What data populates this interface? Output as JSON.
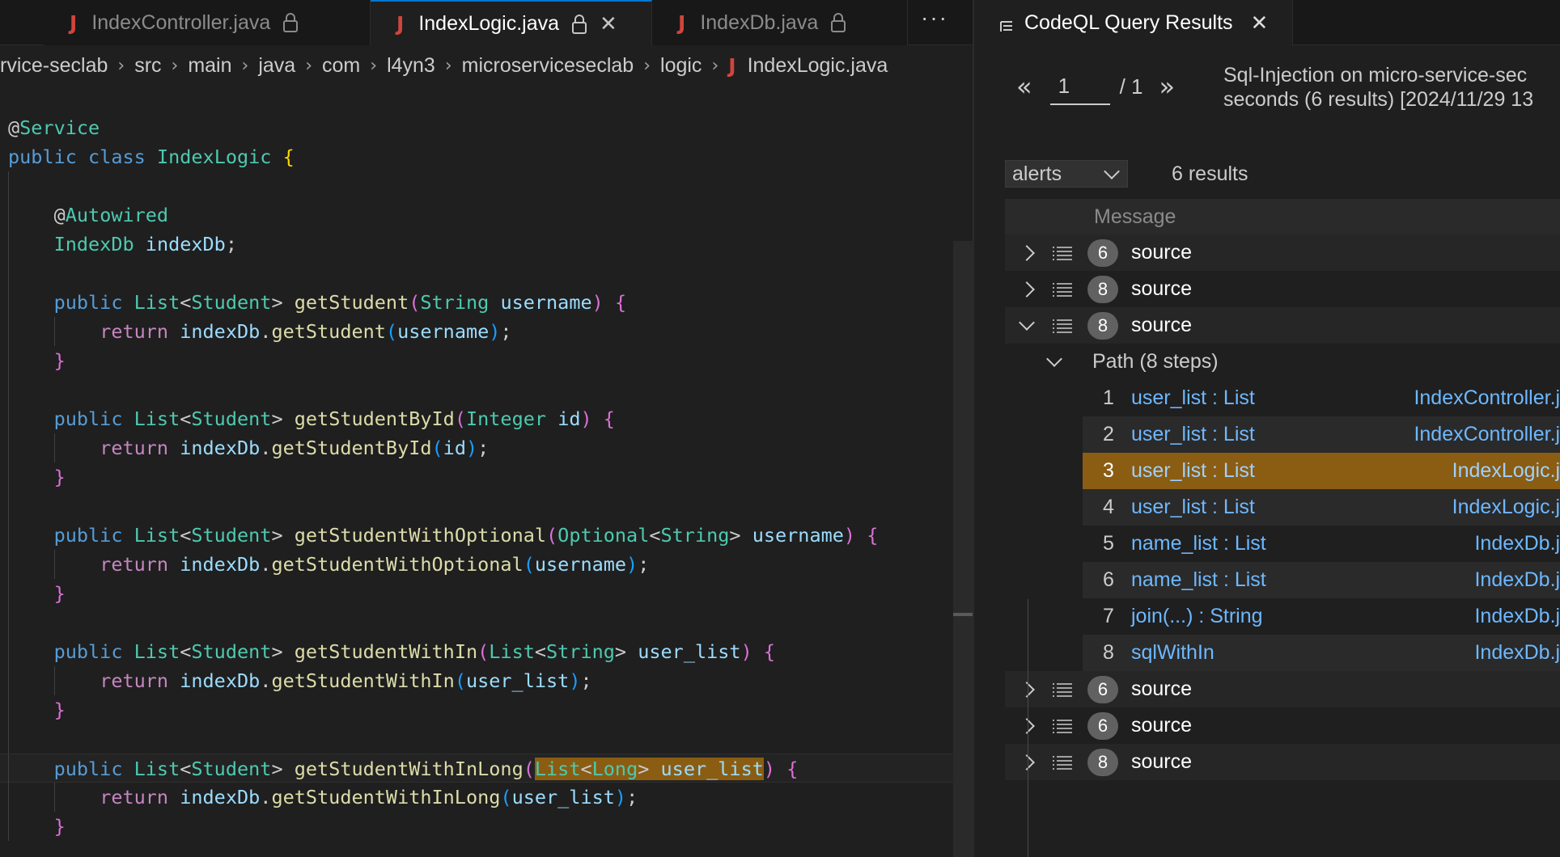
{
  "editor": {
    "tabs": [
      {
        "label": "IndexController.java",
        "locked": true,
        "active": false
      },
      {
        "label": "IndexLogic.java",
        "locked": true,
        "active": true
      },
      {
        "label": "IndexDb.java",
        "locked": true,
        "active": false
      }
    ],
    "more_label": "···",
    "file_icon_glyph": "J",
    "breadcrumb": [
      "rvice-seclab",
      "src",
      "main",
      "java",
      "com",
      "l4yn3",
      "microserviceseclab",
      "logic",
      "IndexLogic.java"
    ],
    "code_lines": [
      "@Service",
      "public class IndexLogic {",
      "",
      "    @Autowired",
      "    IndexDb indexDb;",
      "",
      "    public List<Student> getStudent(String username) {",
      "        return indexDb.getStudent(username);",
      "    }",
      "",
      "    public List<Student> getStudentById(Integer id) {",
      "        return indexDb.getStudentById(id);",
      "    }",
      "",
      "    public List<Student> getStudentWithOptional(Optional<String> username) {",
      "        return indexDb.getStudentWithOptional(username);",
      "    }",
      "",
      "    public List<Student> getStudentWithIn(List<String> user_list) {",
      "        return indexDb.getStudentWithIn(user_list);",
      "    }",
      "",
      "    public List<Student> getStudentWithInLong(List<Long> user_list) {",
      "        return indexDb.getStudentWithInLong(user_list);",
      "    }"
    ],
    "highlighted_text": "List<Long> user_list"
  },
  "results": {
    "tab_label": "CodeQL Query Results",
    "pager": {
      "prev": "«",
      "page": "1",
      "total": "/ 1",
      "next": "»"
    },
    "query_info_line1": "Sql-Injection on micro-service-sec",
    "query_info_line2": "seconds (6 results) [2024/11/29 13",
    "view_select": "alerts",
    "result_count": "6 results",
    "column_header": "Message",
    "alerts": [
      {
        "count": "6",
        "message": "source",
        "expanded": false
      },
      {
        "count": "8",
        "message": "source",
        "expanded": false
      },
      {
        "count": "8",
        "message": "source",
        "expanded": true
      },
      {
        "count": "6",
        "message": "source",
        "expanded": false
      },
      {
        "count": "6",
        "message": "source",
        "expanded": false
      },
      {
        "count": "8",
        "message": "source",
        "expanded": false
      }
    ],
    "path_label": "Path (8 steps)",
    "steps": [
      {
        "num": "1",
        "label": "user_list : List",
        "file": "IndexController.ja"
      },
      {
        "num": "2",
        "label": "user_list : List",
        "file": "IndexController.ja"
      },
      {
        "num": "3",
        "label": "user_list : List",
        "file": "IndexLogic.ja",
        "selected": true
      },
      {
        "num": "4",
        "label": "user_list : List",
        "file": "IndexLogic.ja"
      },
      {
        "num": "5",
        "label": "name_list : List",
        "file": "IndexDb.ja"
      },
      {
        "num": "6",
        "label": "name_list : List",
        "file": "IndexDb.ja"
      },
      {
        "num": "7",
        "label": "join(...) : String",
        "file": "IndexDb.ja"
      },
      {
        "num": "8",
        "label": "sqlWithIn",
        "file": "IndexDb.ja"
      }
    ]
  },
  "colors": {
    "accent": "#0078d4",
    "selection": "#8a5d12",
    "link": "#6db8ff",
    "java_icon": "#d0453d"
  }
}
